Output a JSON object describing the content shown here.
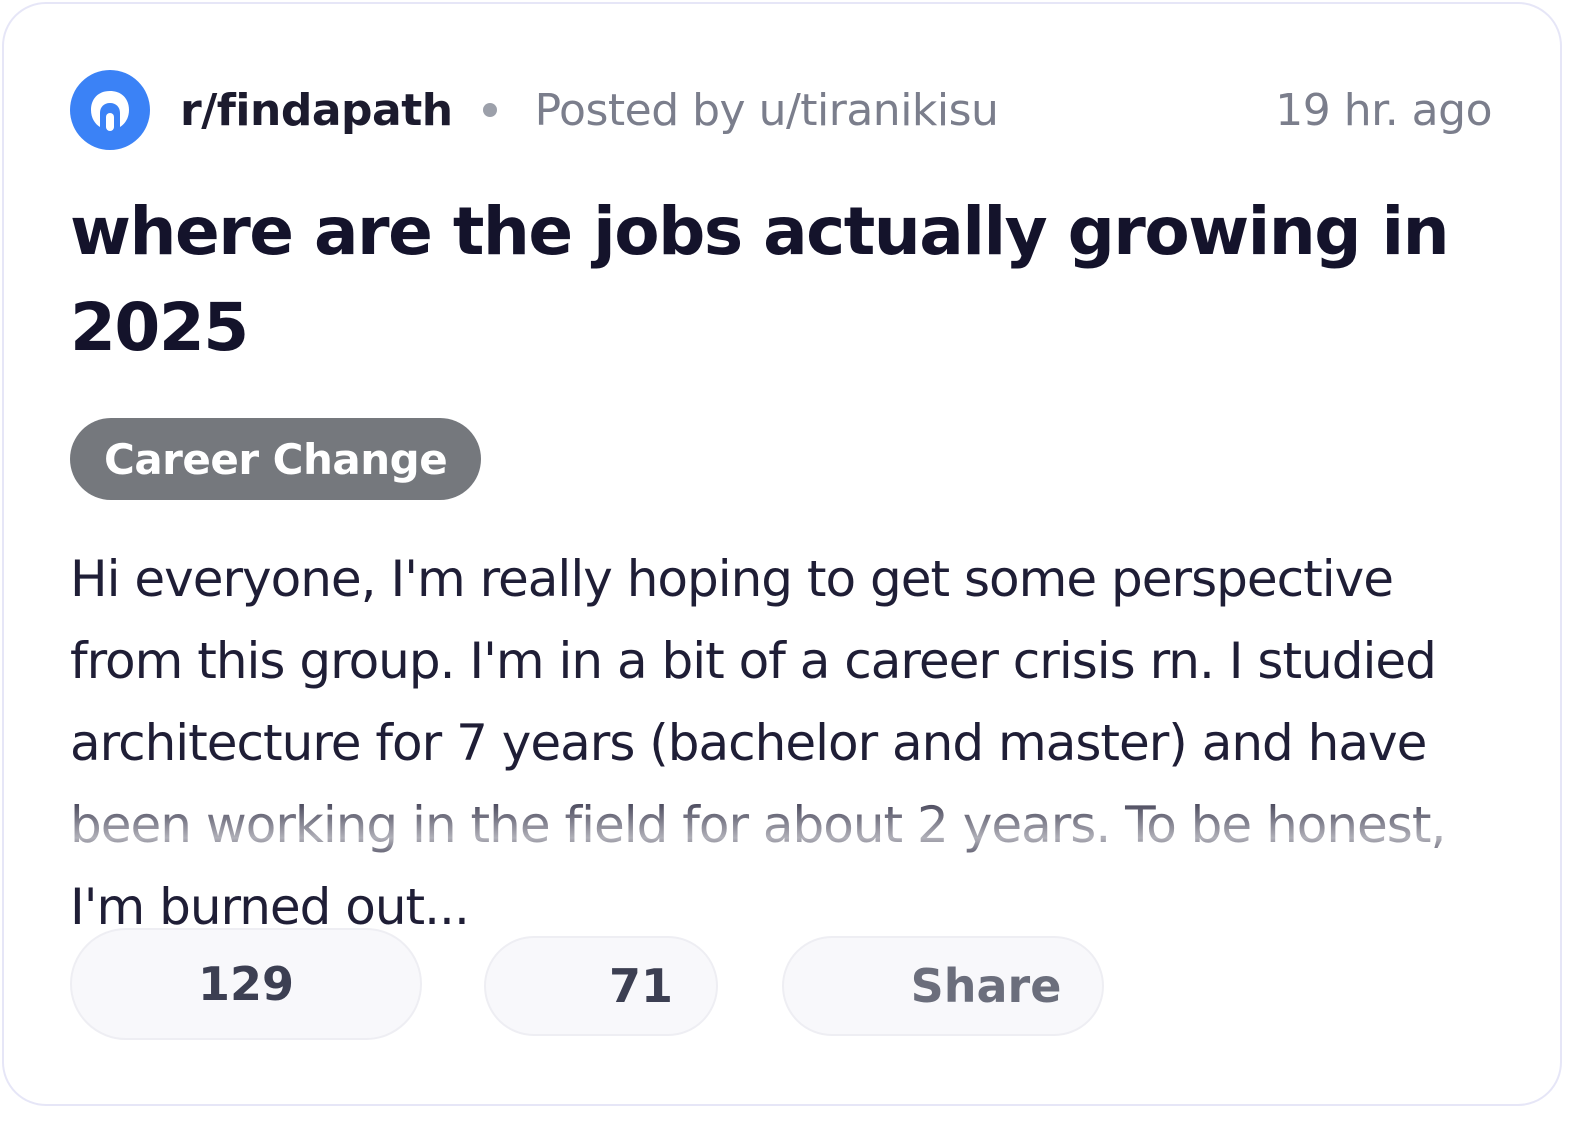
{
  "post": {
    "subreddit": "r/findapath",
    "posted_by": "Posted by u/tiranikisu",
    "time": "19 hr. ago",
    "title": "where are the jobs actually growing in 2025",
    "flair": "Career Change",
    "body": "Hi everyone, I'm really hoping to get some perspective from this group. I'm in a bit of a career crisis rn. I studied architecture for 7 years (bachelor and master) and have been working in the field for about 2 years. To be honest, I'm burned out..."
  },
  "actions": {
    "votes": "129",
    "comments": "71",
    "share_label": "Share"
  },
  "colors": {
    "avatar": "#3b82f6",
    "flair_bg": "#75787d",
    "title": "#14132b",
    "meta": "#7b7e8c"
  },
  "icons": {
    "avatar": "reddit-community-icon"
  }
}
